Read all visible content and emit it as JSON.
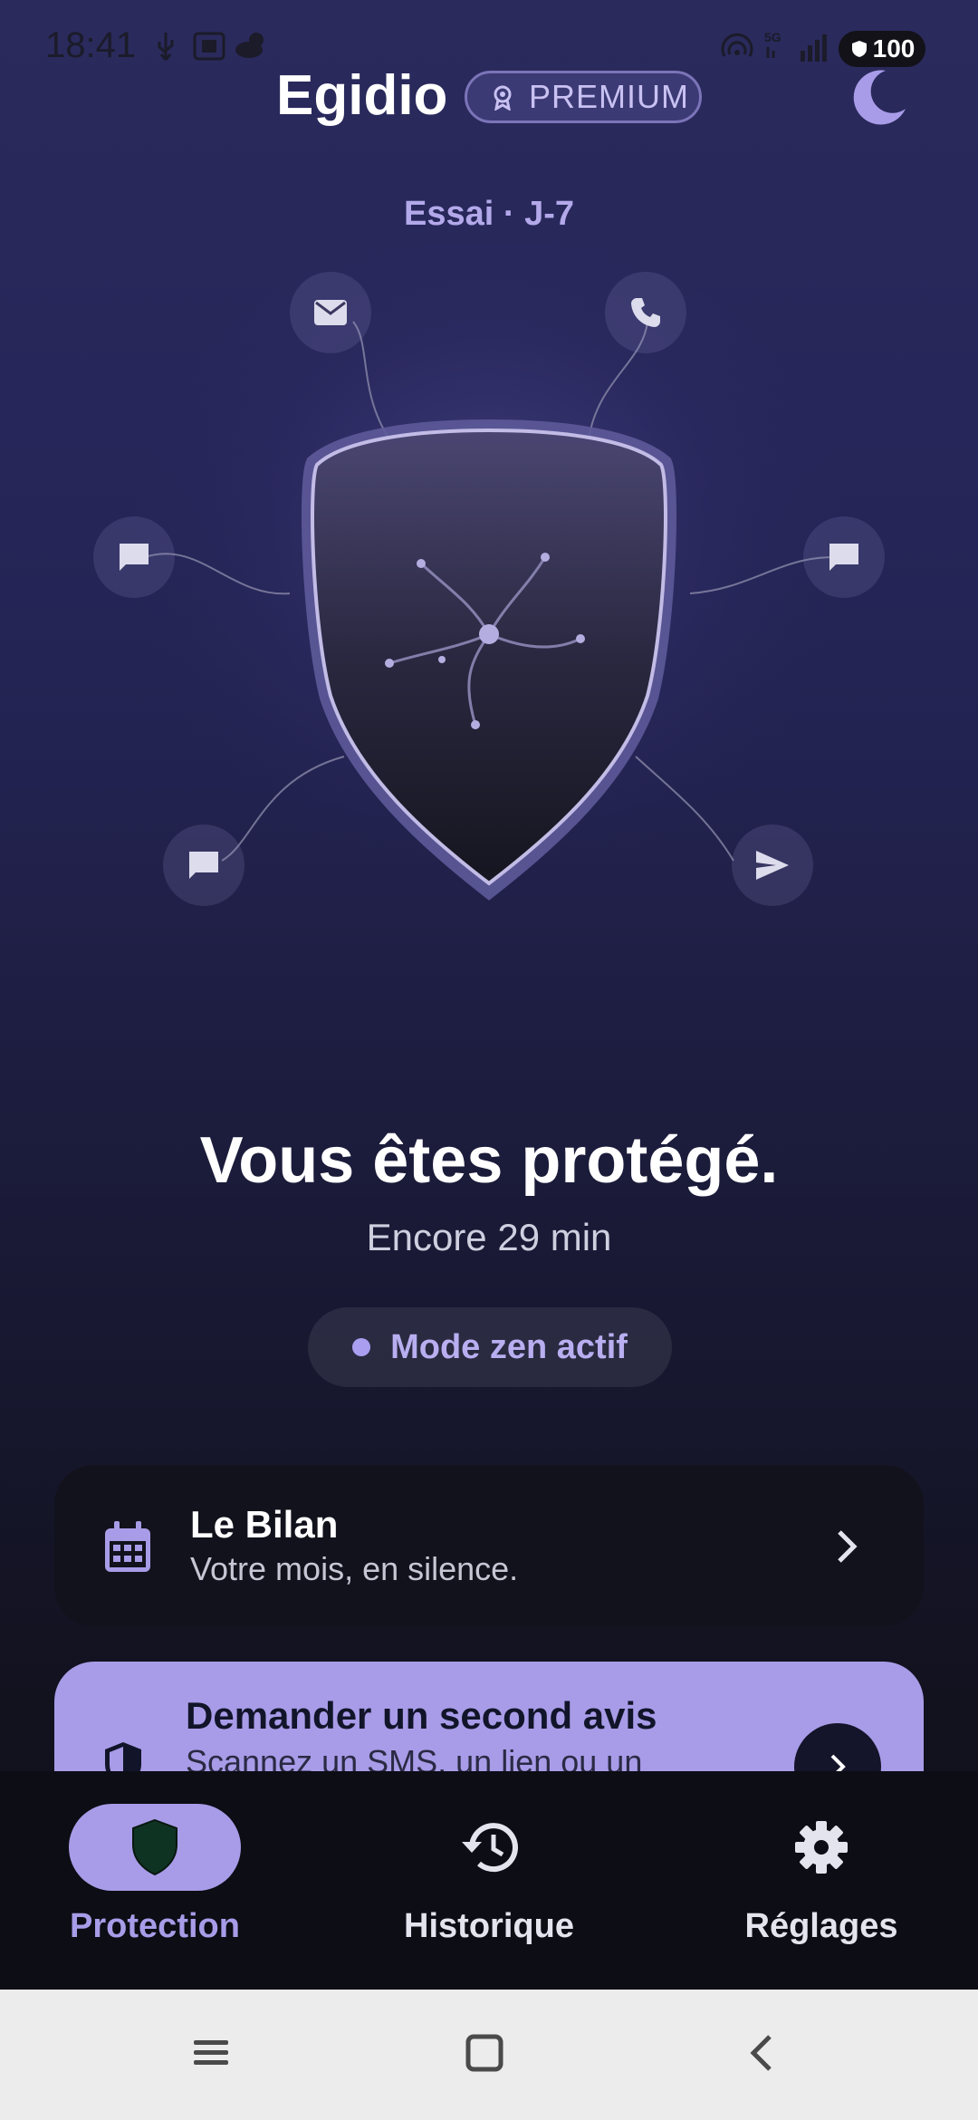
{
  "status_bar": {
    "time": "18:41",
    "battery": "100"
  },
  "header": {
    "title": "Egidio",
    "badge": "PREMIUM"
  },
  "trial": "Essai · J-7",
  "status": {
    "headline": "Vous êtes protégé.",
    "remaining": "Encore 29 min",
    "zen_chip": "Mode zen actif"
  },
  "cards": {
    "bilan": {
      "title": "Le Bilan",
      "subtitle": "Votre mois, en silence."
    },
    "second_opinion": {
      "title": "Demander un second avis",
      "subtitle": "Scannez un SMS, un lien ou un"
    }
  },
  "bottom_nav": {
    "items": [
      {
        "label": "Protection",
        "icon": "shield-icon",
        "active": true
      },
      {
        "label": "Historique",
        "icon": "history-icon",
        "active": false
      },
      {
        "label": "Réglages",
        "icon": "gear-icon",
        "active": false
      }
    ]
  },
  "colors": {
    "accent": "#a89ce8",
    "accent_text": "#b8aef0",
    "background_top": "#2a2a5c",
    "background_bottom": "#0e0e16",
    "nav_bg": "#0c0d15"
  }
}
